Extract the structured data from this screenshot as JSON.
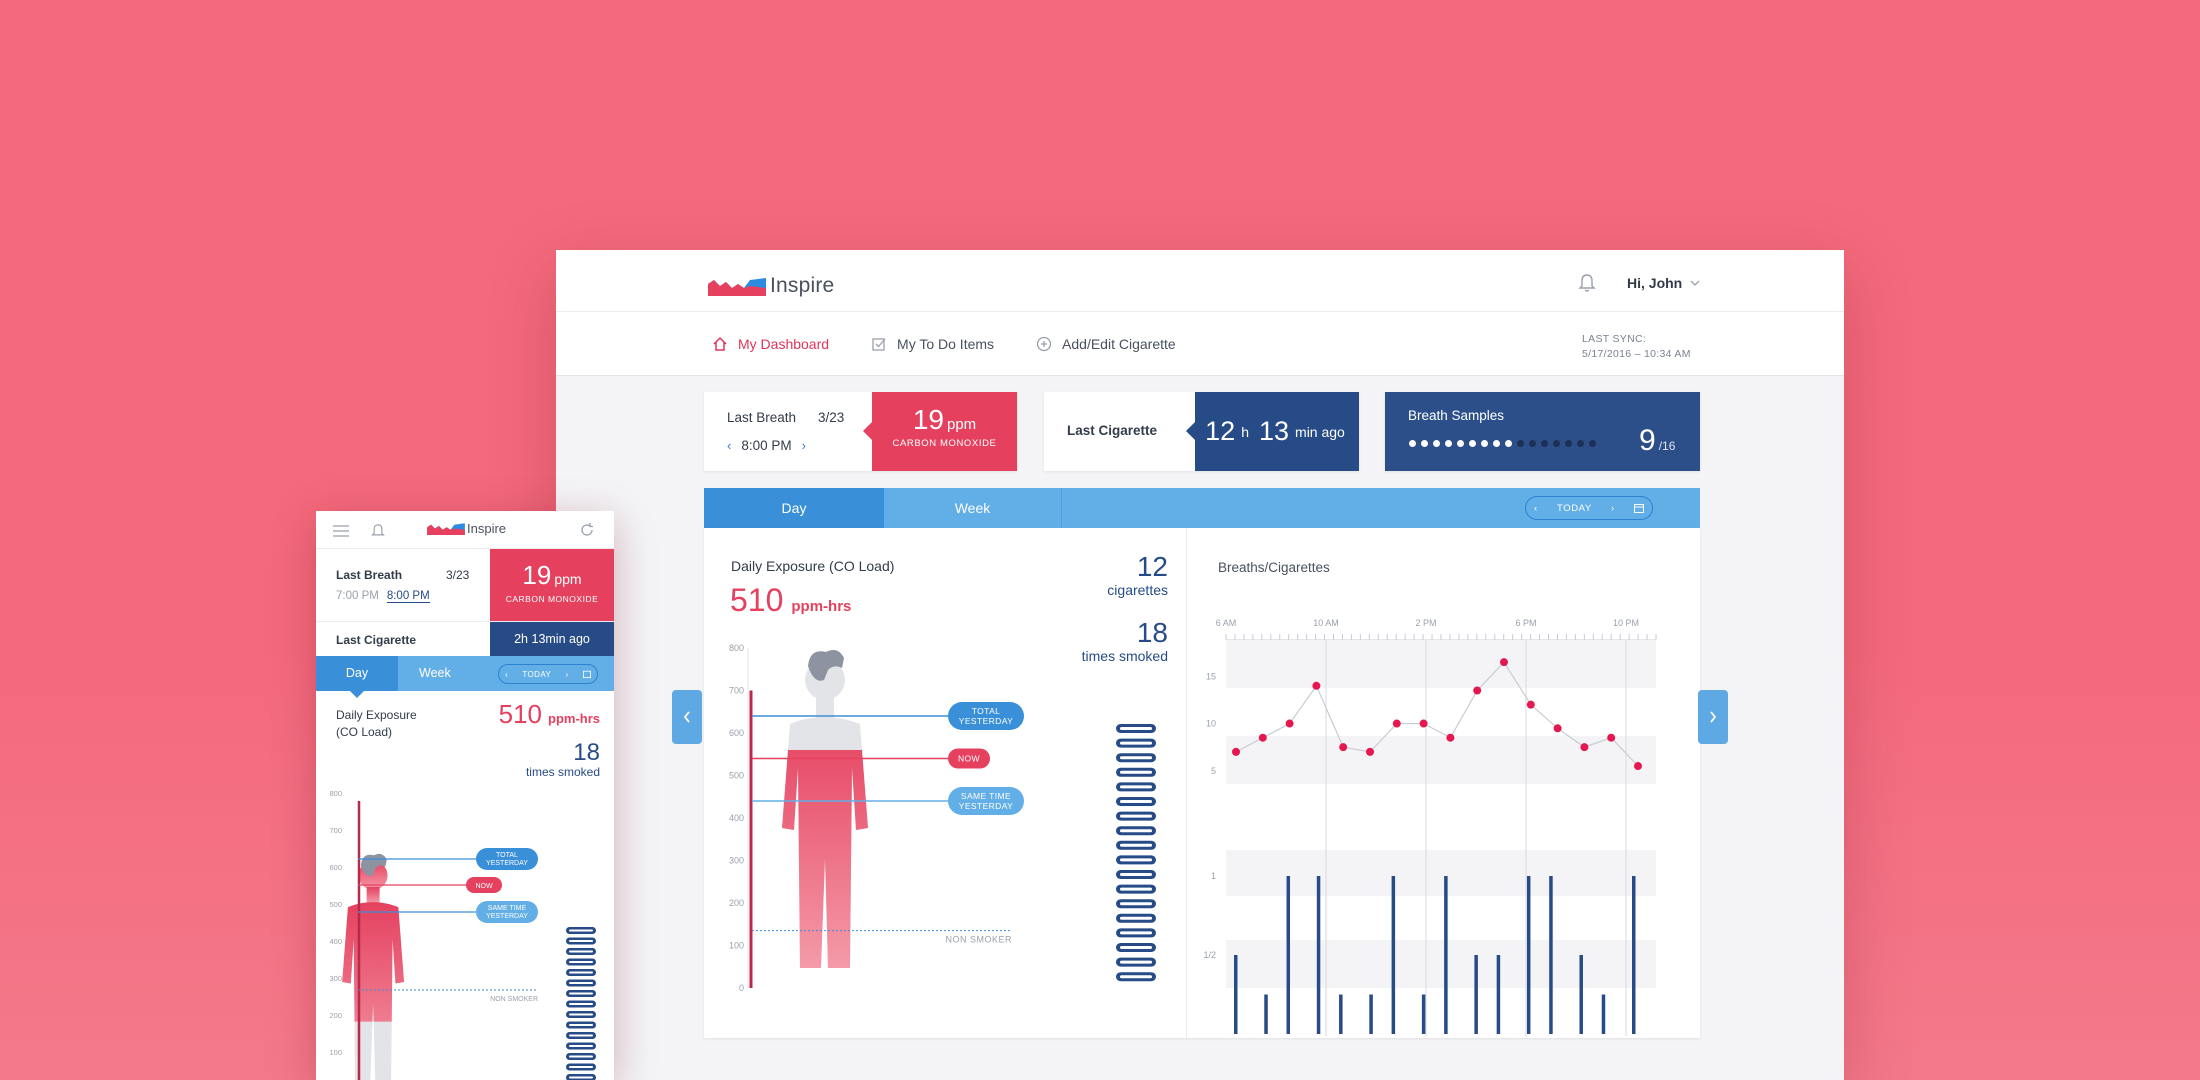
{
  "desktop": {
    "app_name": "Inspire",
    "user": "Hi, John",
    "nav": [
      {
        "label": "My Dashboard",
        "icon": "home-icon",
        "active": true
      },
      {
        "label": "My To Do Items",
        "icon": "checkbox-icon",
        "active": false
      },
      {
        "label": "Add/Edit Cigarette",
        "icon": "plus-circle-icon",
        "active": false
      }
    ],
    "sync": {
      "label": "LAST SYNC:",
      "value": "5/17/2016 – 10:34 AM"
    },
    "last_breath": {
      "label": "Last Breath",
      "date": "3/23",
      "time": "8:00 PM",
      "value": "19",
      "unit": "ppm",
      "sub": "CARBON MONOXIDE"
    },
    "last_cigarette": {
      "label": "Last Cigarette",
      "hours": "12",
      "hours_unit": "h",
      "minutes": "13",
      "minutes_unit": "min ago"
    },
    "breath_samples": {
      "label": "Breath Samples",
      "count": "9",
      "total": "/16",
      "filled": 9,
      "of": 16
    },
    "tabs": {
      "day": "Day",
      "week": "Week",
      "today": "TODAY"
    },
    "exposure": {
      "title": "Daily Exposure",
      "subtitle": "(CO Load)",
      "value": "510",
      "unit": "ppm-hrs",
      "cigarettes": "12",
      "cigarettes_label": "cigarettes",
      "times": "18",
      "times_label": "times smoked",
      "scale": [
        "800",
        "700",
        "600",
        "500",
        "400",
        "300",
        "200",
        "100",
        "0"
      ],
      "markers": [
        {
          "label1": "TOTAL",
          "label2": "YESTERDAY",
          "level": 640
        },
        {
          "label1": "NOW",
          "label2": "",
          "level": 540
        },
        {
          "label1": "SAME TIME",
          "label2": "YESTERDAY",
          "level": 440
        }
      ],
      "fill_level": 560,
      "non_smoker_label": "NON SMOKER",
      "non_smoker_level": 135,
      "bar_count": 18
    },
    "breaths_cigarettes": {
      "title": "Breaths/Cigarettes",
      "x_ticks": [
        "6 AM",
        "10 AM",
        "2 PM",
        "6 PM",
        "10 PM"
      ],
      "y_ticks_breath": [
        "15",
        "10",
        "5"
      ],
      "y_ticks_cig": [
        "1",
        "1/2"
      ]
    }
  },
  "chart_data": {
    "type": "line",
    "title": "Breaths/Cigarettes",
    "x": [
      "6 AM",
      "10 AM",
      "2 PM",
      "6 PM",
      "10 PM"
    ],
    "series": [
      {
        "values": [
          7,
          8.5,
          10,
          14,
          7.5,
          7,
          10,
          10,
          8.5,
          13.5,
          16.5,
          12,
          9.5,
          7.5,
          8.5,
          5.5
        ]
      }
    ],
    "cigarettes": [
      0.5,
      0.25,
      1,
      1,
      0.25,
      0.25,
      1,
      0.25,
      1,
      0.5,
      0.5,
      1,
      1,
      0.5,
      0.25,
      1
    ],
    "ylim": [
      0,
      18
    ]
  },
  "mobile": {
    "app_name": "Inspire",
    "last_breath": {
      "label": "Last Breath",
      "date": "3/23",
      "times": [
        "7:00 PM",
        "8:00 PM"
      ],
      "value": "19",
      "unit": "ppm",
      "sub": "CARBON MONOXIDE"
    },
    "last_cigarette": {
      "label": "Last Cigarette",
      "value": "2h 13min ago"
    },
    "tabs": {
      "day": "Day",
      "week": "Week",
      "today": "TODAY"
    },
    "exposure": {
      "title": "Daily Exposure",
      "subtitle": "(CO Load)",
      "value": "510",
      "unit": "ppm-hrs",
      "times": "18",
      "times_label": "times smoked",
      "scale": [
        "800",
        "700",
        "600",
        "500",
        "400",
        "300",
        "200",
        "100"
      ],
      "non_smoker_label": "NON SMOKER"
    }
  },
  "colors": {
    "brand_red": "#e5415f",
    "brand_navy": "#264b86",
    "brand_blue": "#3a8fd9",
    "light_blue": "#62aee7",
    "background": "#f46a7c"
  }
}
